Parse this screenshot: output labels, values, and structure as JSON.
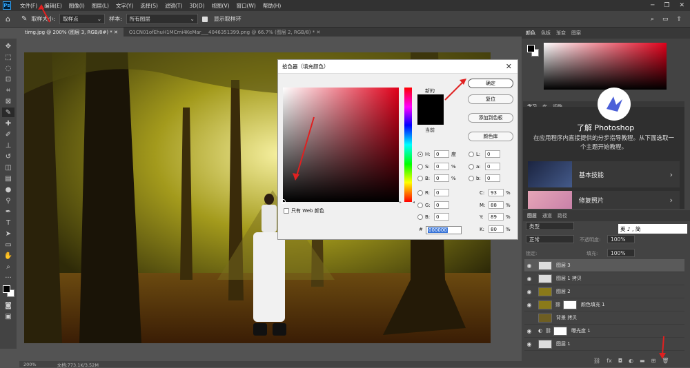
{
  "app": {
    "logo": "Ps",
    "menu": [
      "文件(F)",
      "编辑(E)",
      "图像(I)",
      "图层(L)",
      "文字(Y)",
      "选择(S)",
      "滤镜(T)",
      "3D(D)",
      "视图(V)",
      "窗口(W)",
      "帮助(H)"
    ]
  },
  "options": {
    "sample_size_label": "取样大小:",
    "sample_size_value": "取样点",
    "sample_label": "样本:",
    "sample_value": "所有图层",
    "show_ring_label": "显示取样环"
  },
  "tabs": [
    {
      "label": "timg.jpg @ 200% (图层 3, RGB/8#) *"
    },
    {
      "label": "O1CN01ofEhuH1MCmi4KeMar___4046351399.png @ 66.7% (图层 2, RGB/8) *"
    }
  ],
  "status": {
    "zoom": "200%",
    "doc": "文档:773.1K/3.52M"
  },
  "dialog": {
    "title": "拾色器（填充颜色）",
    "new_label": "新的",
    "current_label": "当前",
    "ok": "确定",
    "reset": "复位",
    "add_swatch": "添加到色板",
    "color_lib": "颜色库",
    "web_only": "只有 Web 颜色",
    "hsb": [
      {
        "k": "H:",
        "v": "0",
        "u": "度"
      },
      {
        "k": "S:",
        "v": "0",
        "u": "%"
      },
      {
        "k": "B:",
        "v": "0",
        "u": "%"
      }
    ],
    "rgb": [
      {
        "k": "R:",
        "v": "0"
      },
      {
        "k": "G:",
        "v": "0"
      },
      {
        "k": "B:",
        "v": "0"
      }
    ],
    "lab": [
      {
        "k": "L:",
        "v": "0"
      },
      {
        "k": "a:",
        "v": "0"
      },
      {
        "k": "b:",
        "v": "0"
      }
    ],
    "cmyk": [
      {
        "k": "C:",
        "v": "93",
        "u": "%"
      },
      {
        "k": "M:",
        "v": "88",
        "u": "%"
      },
      {
        "k": "Y:",
        "v": "89",
        "u": "%"
      },
      {
        "k": "K:",
        "v": "80",
        "u": "%"
      }
    ],
    "hex_label": "#",
    "hex": "000000"
  },
  "color_panel_tabs": [
    "颜色",
    "色板",
    "渐变",
    "图案"
  ],
  "learn": {
    "tabs": [
      "学习",
      "库",
      "调整"
    ],
    "title": "了解 Photoshop",
    "desc": "在应用程序内直接提供的分步指导教程。从下面选取一个主题开始教程。",
    "cards": [
      "基本技能",
      "修复照片"
    ]
  },
  "layers_panel": {
    "tabs": [
      "图层",
      "通道",
      "路径"
    ],
    "filter": "类型",
    "blend": "正常",
    "opacity_label": "不透明度:",
    "opacity": "100%",
    "lock_label": "锁定:",
    "fill_label": "填充:",
    "fill": "100%",
    "layers": [
      {
        "name": "图层 3"
      },
      {
        "name": "图层 1 拷贝"
      },
      {
        "name": "图层 2"
      },
      {
        "name": "颜色填充 1"
      },
      {
        "name": "背景 拷贝"
      },
      {
        "name": "曝光度 1"
      },
      {
        "name": "图层 1"
      }
    ]
  },
  "ime": "英 ♪ , 简"
}
